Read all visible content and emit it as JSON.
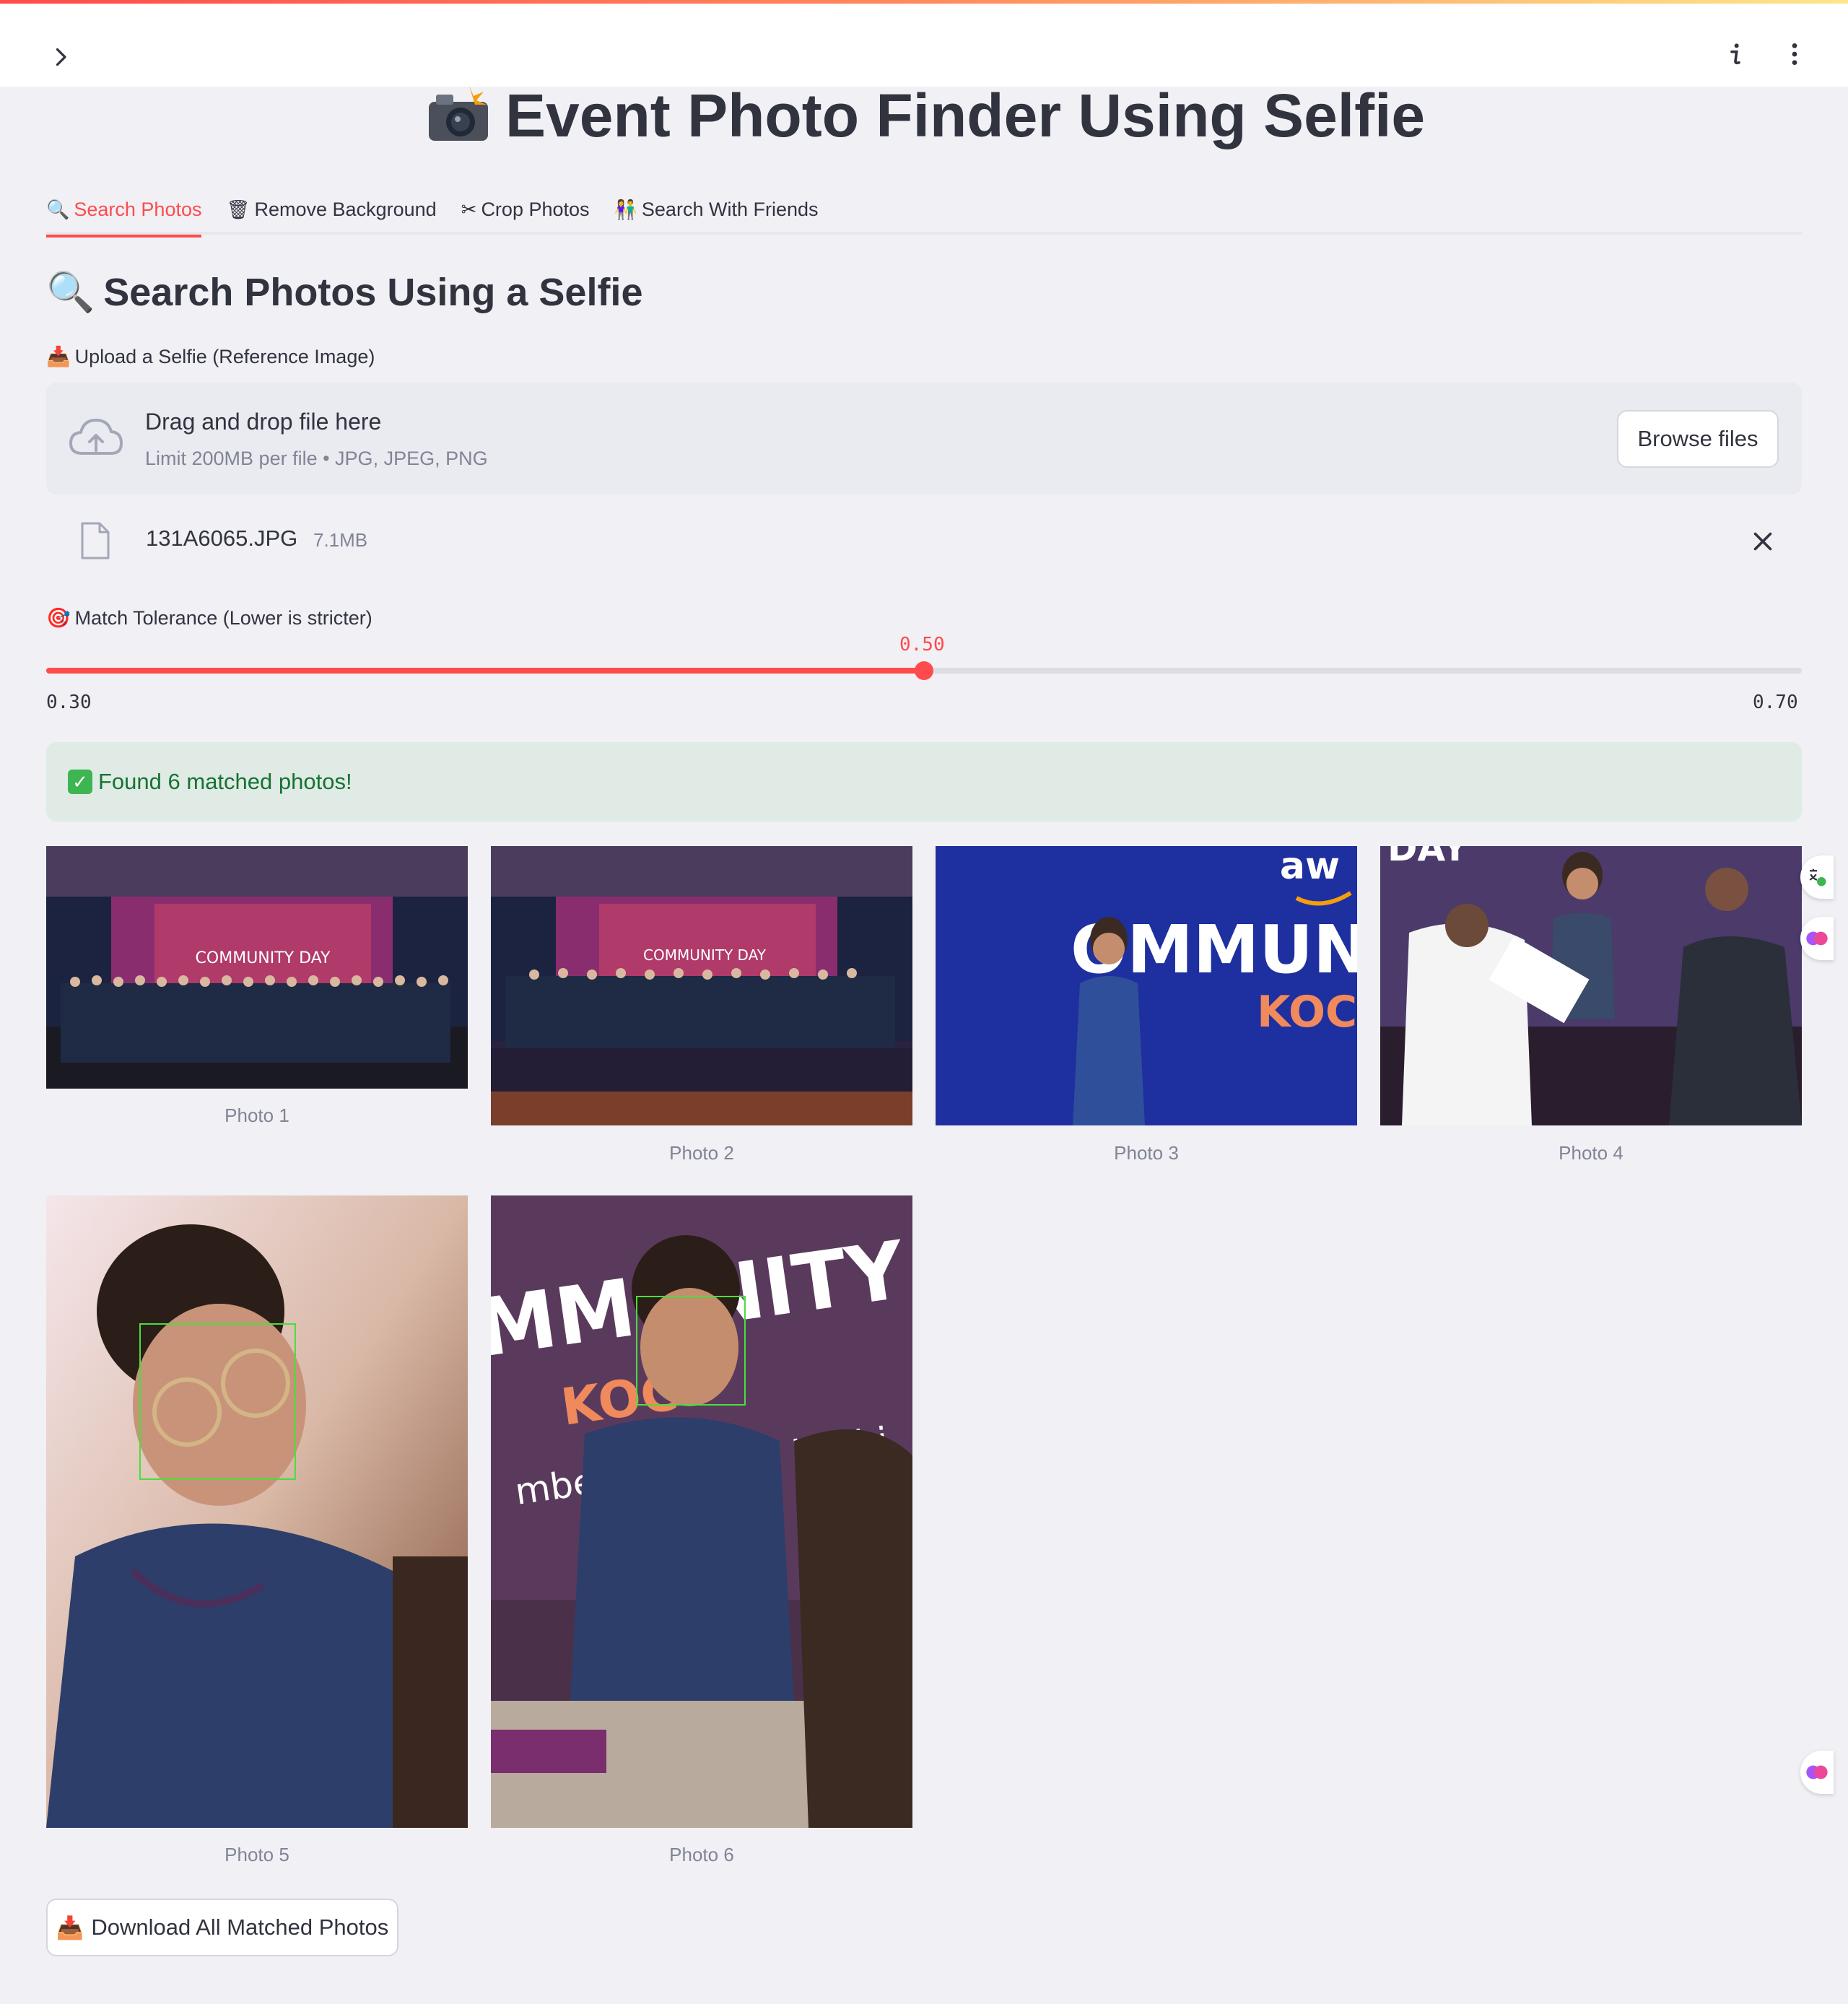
{
  "app": {
    "title": "Event Photo Finder Using Selfie",
    "title_icon": "camera-flash-icon"
  },
  "tabs": [
    {
      "label": "Search Photos",
      "icon": "magnifier-icon",
      "active": true
    },
    {
      "label": "Remove Background",
      "icon": "trash-icon",
      "active": false
    },
    {
      "label": "Crop Photos",
      "icon": "scissors-icon",
      "active": false
    },
    {
      "label": "Search With Friends",
      "icon": "friends-icon",
      "active": false
    }
  ],
  "search": {
    "heading": "Search Photos Using a Selfie",
    "upload_label": "Upload a Selfie (Reference Image)",
    "dropzone_title": "Drag and drop file here",
    "dropzone_limit": "Limit 200MB per file • JPG, JPEG, PNG",
    "browse_label": "Browse files",
    "uploaded_file": {
      "name": "131A6065.JPG",
      "size": "7.1MB"
    },
    "tolerance_label": "Match Tolerance (Lower is stricter)",
    "tolerance": {
      "value": "0.50",
      "min": "0.30",
      "max": "0.70",
      "fraction": 0.5
    },
    "success_message": "Found 6 matched photos!",
    "photos": [
      {
        "caption": "Photo 1"
      },
      {
        "caption": "Photo 2"
      },
      {
        "caption": "Photo 3"
      },
      {
        "caption": "Photo 4"
      },
      {
        "caption": "Photo 5"
      },
      {
        "caption": "Photo 6"
      }
    ],
    "download_label": "Download All Matched Photos"
  },
  "colors": {
    "accent": "#ff4b4b",
    "success_bg": "#dfebe4",
    "success_text": "#177233",
    "background": "#f0f0f5"
  }
}
